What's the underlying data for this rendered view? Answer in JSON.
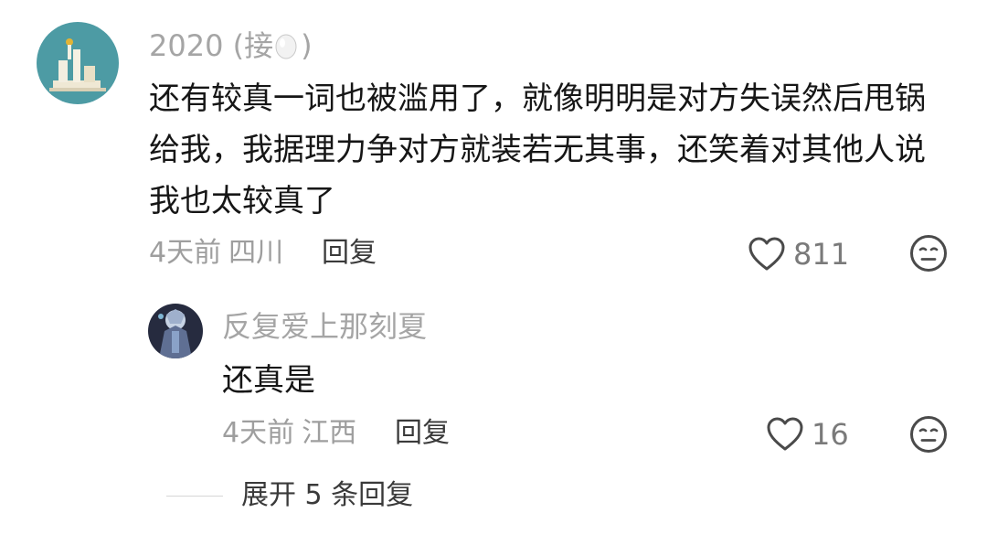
{
  "comment": {
    "author_prefix": "2020 (接",
    "author_suffix": ")",
    "author_icon": "egg-icon",
    "content_lines": [
      "还有较真一词也被滥用了，就像明明是对方失误然后甩锅",
      "给我，我据理力争对方就装若无其事，还笑着对其他人说",
      "我也太较真了"
    ],
    "time": "4天前",
    "location": "四川",
    "reply_label": "回复",
    "likes": "811"
  },
  "reply": {
    "author": "反复爱上那刻夏",
    "content": "还真是",
    "time": "4天前",
    "location": "江西",
    "reply_label": "回复",
    "likes": "16"
  },
  "expand": {
    "label": "展开 5 条回复"
  },
  "colors": {
    "avatar_bg": "#4d9ba4",
    "meta_gray": "#9e9e9e",
    "text": "#161616"
  }
}
